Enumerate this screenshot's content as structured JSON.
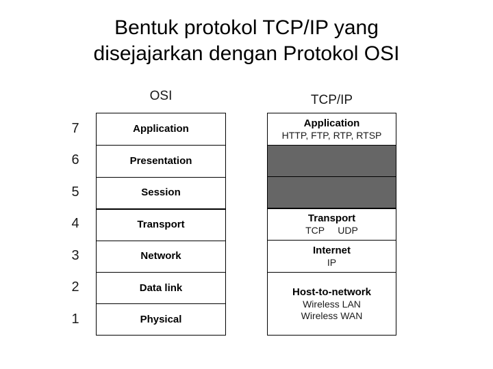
{
  "slide": {
    "title_line1": "Bentuk protokol TCP/IP yang",
    "title_line2": "disejajarkan dengan Protokol OSI",
    "background_color": "#ffffff",
    "text_color": "#000000",
    "gray_block_color": "#666666"
  },
  "osi": {
    "header": "OSI",
    "numbers": [
      "7",
      "6",
      "5",
      "4",
      "3",
      "2",
      "1"
    ],
    "layers": [
      {
        "number": "7",
        "name": "Application"
      },
      {
        "number": "6",
        "name": "Presentation"
      },
      {
        "number": "5",
        "name": "Session"
      },
      {
        "number": "4",
        "name": "Transport"
      },
      {
        "number": "3",
        "name": "Network"
      },
      {
        "number": "2",
        "name": "Data link"
      },
      {
        "number": "1",
        "name": "Physical"
      }
    ]
  },
  "tcpip": {
    "header": "TCP/IP",
    "layers": [
      {
        "name": "Application",
        "protocols": "HTTP, FTP, RTP, RTSP",
        "filled": false
      },
      {
        "name": "",
        "protocols": "",
        "filled": true
      },
      {
        "name": "",
        "protocols": "",
        "filled": true
      },
      {
        "name": "Transport",
        "protocols": "TCP     UDP",
        "filled": false
      },
      {
        "name": "Internet",
        "protocols": "IP",
        "filled": false
      },
      {
        "name": "Host-to-network",
        "protocols": "Wireless LAN\nWireless WAN",
        "filled": false
      }
    ]
  }
}
